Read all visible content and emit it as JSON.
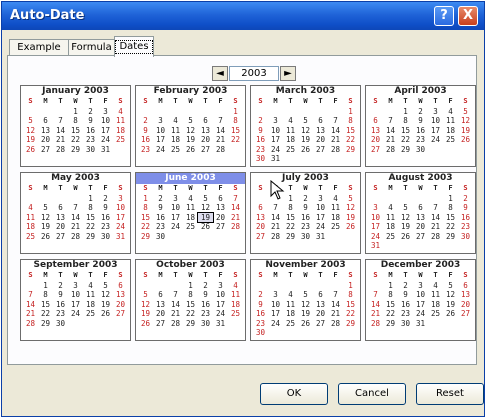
{
  "window": {
    "title": "Auto-Date",
    "help_label": "?",
    "close_label": "X"
  },
  "tabs": [
    {
      "label": "Example"
    },
    {
      "label": "Formula"
    },
    {
      "label": "Dates"
    }
  ],
  "year_nav": {
    "year": "2003",
    "prev_icon": "◄",
    "next_icon": "►"
  },
  "weekday_headers": [
    "S",
    "M",
    "T",
    "W",
    "T",
    "F",
    "S"
  ],
  "months": [
    {
      "name": "January 2003",
      "offset": 3,
      "days": 31
    },
    {
      "name": "February 2003",
      "offset": 6,
      "days": 28
    },
    {
      "name": "March 2003",
      "offset": 6,
      "days": 31
    },
    {
      "name": "April 2003",
      "offset": 2,
      "days": 30
    },
    {
      "name": "May 2003",
      "offset": 4,
      "days": 31
    },
    {
      "name": "June 2003",
      "offset": 0,
      "days": 30,
      "selected": true,
      "highlight_day": 19
    },
    {
      "name": "July 2003",
      "offset": 2,
      "days": 31
    },
    {
      "name": "August 2003",
      "offset": 5,
      "days": 31
    },
    {
      "name": "September 2003",
      "offset": 1,
      "days": 30
    },
    {
      "name": "October 2003",
      "offset": 3,
      "days": 31
    },
    {
      "name": "November 2003",
      "offset": 6,
      "days": 30
    },
    {
      "name": "December 2003",
      "offset": 1,
      "days": 31
    }
  ],
  "buttons": {
    "ok": "OK",
    "cancel": "Cancel",
    "reset": "Reset"
  },
  "colors": {
    "weekend": "#c42020",
    "selected_header": "#7e8ee8",
    "titlebar": "#1f63d8"
  }
}
